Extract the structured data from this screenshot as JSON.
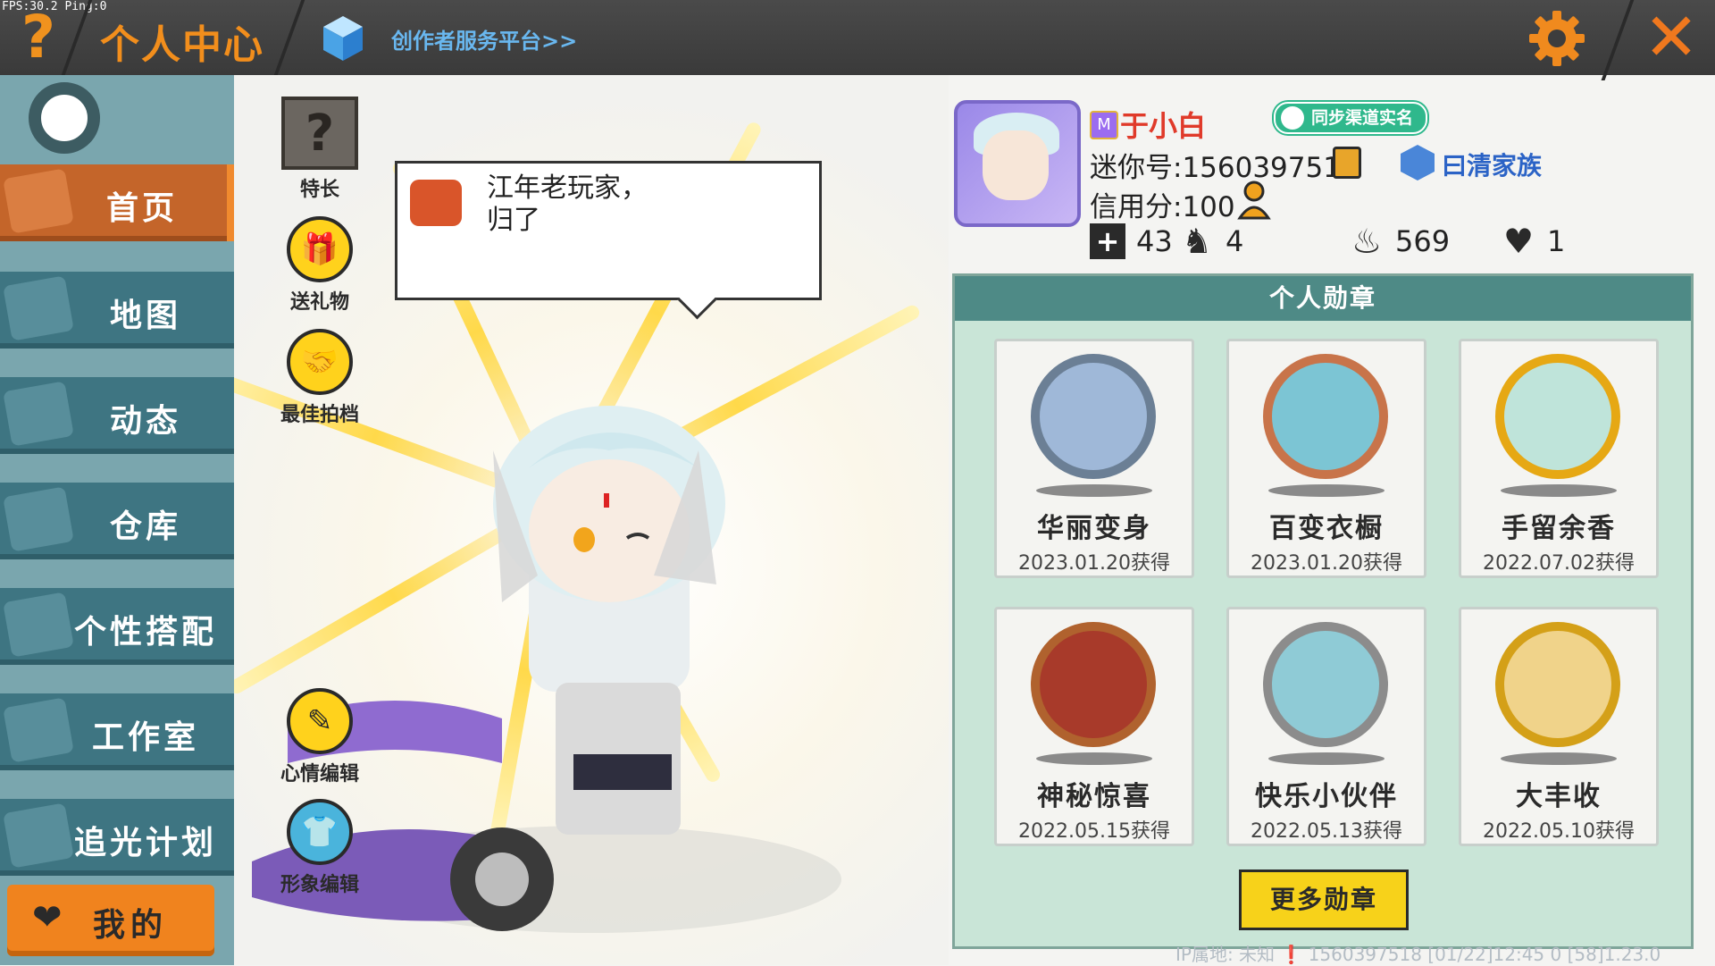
{
  "debug": {
    "fps_text": "FPS:30.2 Ping:0"
  },
  "header": {
    "help_icon_glyph": "?",
    "title": "个人中心",
    "creator_link": "创作者服务平台>>",
    "close_glyph": "✕",
    "accent_color": "#f28e1c"
  },
  "sidebar": {
    "items": [
      {
        "label": "首页",
        "icon": "house-icon",
        "active": true
      },
      {
        "label": "地图",
        "icon": "map-icon",
        "active": false
      },
      {
        "label": "动态",
        "icon": "bell-icon",
        "active": false
      },
      {
        "label": "仓库",
        "icon": "warehouse-icon",
        "active": false
      },
      {
        "label": "个性搭配",
        "icon": "outfit-icon",
        "active": false
      },
      {
        "label": "工作室",
        "icon": "studio-icon",
        "active": false
      },
      {
        "label": "追光计划",
        "icon": "spotlight-icon",
        "active": false
      }
    ],
    "mine": {
      "label": "我的",
      "icon": "heart-icon"
    }
  },
  "actions": {
    "talent": {
      "label": "特长",
      "glyph": "?"
    },
    "gift": {
      "label": "送礼物"
    },
    "partner": {
      "label": "最佳拍档"
    },
    "mood": {
      "label": "心情编辑"
    },
    "appearance": {
      "label": "形象编辑"
    }
  },
  "speech": {
    "text": "江年老玩家，ㅤ\n归了"
  },
  "profile": {
    "vip_badge": "M",
    "nickname": "于小白",
    "sync_badge": "同步渠道实名",
    "mini_id": "迷你号:1560397518",
    "family": "曰清家族",
    "credit": "信用分:100",
    "stats": {
      "add": "43",
      "fans": "4",
      "heat": "569",
      "likes": "1"
    }
  },
  "medals": {
    "header": "个人勋章",
    "items": [
      {
        "name": "华丽变身",
        "date": "2023.01.20获得",
        "ring": "#6b7f95",
        "fill": "#9fb8d8"
      },
      {
        "name": "百变衣橱",
        "date": "2023.01.20获得",
        "ring": "#c8744a",
        "fill": "#7cc5d4"
      },
      {
        "name": "手留余香",
        "date": "2022.07.02获得",
        "ring": "#e6a814",
        "fill": "#bfe4da"
      },
      {
        "name": "神秘惊喜",
        "date": "2022.05.15获得",
        "ring": "#b0622e",
        "fill": "#a83a2a"
      },
      {
        "name": "快乐小伙伴",
        "date": "2022.05.13获得",
        "ring": "#8c8c8c",
        "fill": "#8fcbd6"
      },
      {
        "name": "大丰收",
        "date": "2022.05.10获得",
        "ring": "#d4a018",
        "fill": "#f0d38a"
      }
    ],
    "more_button": "更多勋章"
  },
  "footer": {
    "text": "IP属地: 未知 ❗ 1560397518 [01/22]12:45 0 [58]1.23.0"
  }
}
